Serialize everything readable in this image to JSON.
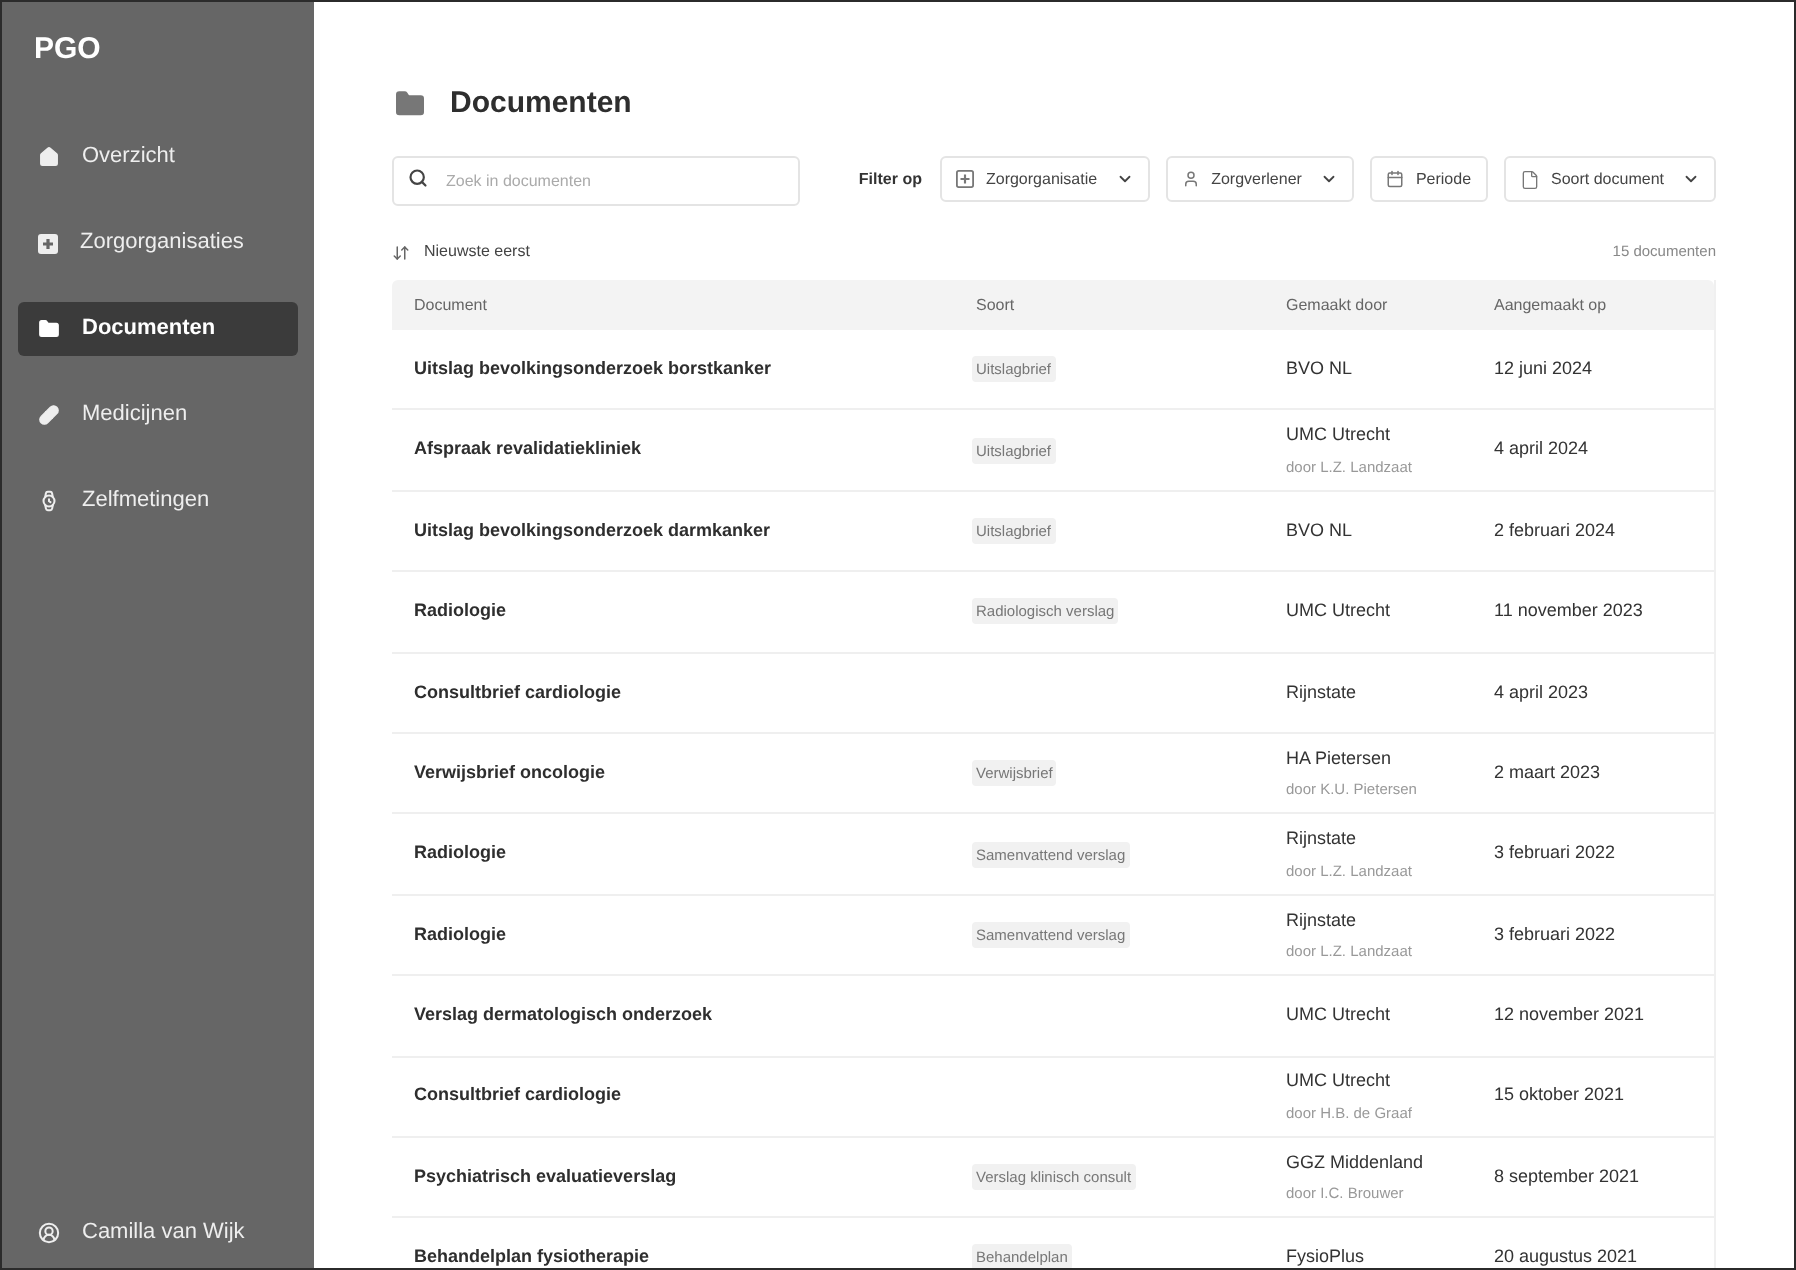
{
  "sidebar": {
    "logo": "PGO",
    "items": [
      {
        "label": "Overzicht",
        "selected": false
      },
      {
        "label": "Zorgorganisaties",
        "selected": false
      },
      {
        "label": "Documenten",
        "selected": true
      },
      {
        "label": "Medicijnen",
        "selected": false
      },
      {
        "label": "Zelfmetingen",
        "selected": false
      }
    ],
    "user": {
      "name": "Camilla van Wijk"
    }
  },
  "page": {
    "title": "Documenten"
  },
  "search": {
    "placeholder": "Zoek in documenten"
  },
  "filters": {
    "label": "Filter op",
    "buttons": [
      {
        "label": "Zorgorganisatie",
        "dropdown": true
      },
      {
        "label": "Zorgverlener",
        "dropdown": true
      },
      {
        "label": "Periode",
        "dropdown": false
      },
      {
        "label": "Soort document",
        "dropdown": true
      }
    ]
  },
  "sort": {
    "label": "Nieuwste eerst"
  },
  "count": "15 documenten",
  "table": {
    "columns": [
      "Document",
      "Soort",
      "Gemaakt door",
      "Aangemaakt op"
    ],
    "rows": [
      {
        "document": "Uitslag bevolkingsonderzoek borstkanker",
        "soort": "Uitslagbrief",
        "maker": "BVO NL",
        "date": "12 juni 2024"
      },
      {
        "document": "Afspraak revalidatiekliniek",
        "soort": "Uitslagbrief",
        "maker": "UMC Utrecht",
        "maker_detail": "door L.Z. Landzaat",
        "date": "4 april 2024"
      },
      {
        "document": "Uitslag bevolkingsonderzoek darmkanker",
        "soort": "Uitslagbrief",
        "maker": "BVO NL",
        "date": "2 februari 2024"
      },
      {
        "document": "Radiologie",
        "soort": "Radiologisch verslag",
        "maker": "UMC Utrecht",
        "date": "11 november 2023"
      },
      {
        "document": "Consultbrief cardiologie",
        "maker": "Rijnstate",
        "date": "4 april 2023"
      },
      {
        "document": "Verwijsbrief oncologie",
        "soort": "Verwijsbrief",
        "maker": "HA Pietersen",
        "maker_detail": "door K.U. Pietersen",
        "date": "2 maart 2023"
      },
      {
        "document": "Radiologie",
        "soort": "Samenvattend verslag",
        "maker": "Rijnstate",
        "maker_detail": "door L.Z. Landzaat",
        "date": "3 februari 2022"
      },
      {
        "document": "Radiologie",
        "soort": "Samenvattend verslag",
        "maker": "Rijnstate",
        "maker_detail": "door L.Z. Landzaat",
        "date": "3 februari 2022"
      },
      {
        "document": "Verslag dermatologisch onderzoek",
        "maker": "UMC Utrecht",
        "date": "12 november 2021"
      },
      {
        "document": "Consultbrief cardiologie",
        "maker": "UMC Utrecht",
        "maker_detail": "door H.B. de Graaf",
        "date": "15 oktober 2021"
      },
      {
        "document": "Psychiatrisch evaluatieverslag",
        "soort": "Verslag klinisch consult",
        "maker": "GGZ Middenland",
        "maker_detail": "door I.C. Brouwer",
        "date": "8 september 2021"
      },
      {
        "document": "Behandelplan fysiotherapie",
        "soort": "Behandelplan",
        "maker": "FysioPlus",
        "date": "20 augustus 2021"
      }
    ]
  }
}
